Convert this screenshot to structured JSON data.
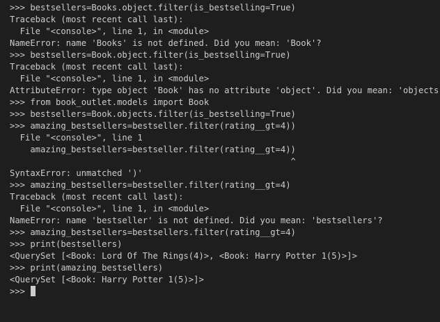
{
  "terminal": {
    "lines": [
      ">>> bestsellers=Books.object.filter(is_bestselling=True)",
      "Traceback (most recent call last):",
      "  File \"<console>\", line 1, in <module>",
      "NameError: name 'Books' is not defined. Did you mean: 'Book'?",
      ">>> bestsellers=Book.object.filter(is_bestselling=True)",
      "Traceback (most recent call last):",
      "  File \"<console>\", line 1, in <module>",
      "AttributeError: type object 'Book' has no attribute 'object'. Did you mean: 'objects'?",
      ">>> from book_outlet.models import Book",
      ">>> bestsellers=Book.objects.filter(is_bestselling=True)",
      ">>> amazing_bestsellers=bestseller.filter(rating__gt=4))",
      "  File \"<console>\", line 1",
      "    amazing_bestsellers=bestseller.filter(rating__gt=4))",
      "                                                       ^",
      "SyntaxError: unmatched ')'",
      ">>> amazing_bestsellers=bestseller.filter(rating__gt=4)",
      "Traceback (most recent call last):",
      "  File \"<console>\", line 1, in <module>",
      "NameError: name 'bestseller' is not defined. Did you mean: 'bestsellers'?",
      ">>> amazing_bestsellers=bestsellers.filter(rating__gt=4)",
      ">>> print(bestsellers)",
      "<QuerySet [<Book: Lord Of The Rings(4)>, <Book: Harry Potter 1(5)>]>",
      ">>> print(amazing_bestsellers)",
      "<QuerySet [<Book: Harry Potter 1(5)>]>"
    ],
    "prompt": ">>> ",
    "colors": {
      "background": "#1e1e1e",
      "foreground": "#cccccc"
    }
  }
}
